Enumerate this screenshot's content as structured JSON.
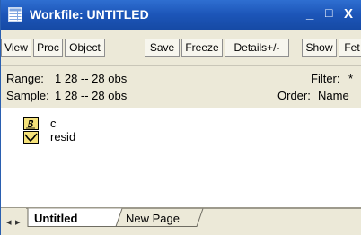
{
  "window": {
    "title": "Workfile: UNTITLED",
    "controls": {
      "minimize": "_",
      "maximize": "□",
      "close": "X"
    }
  },
  "toolbar": {
    "buttons": [
      "View",
      "Proc",
      "Object",
      "Save",
      "Freeze",
      "Details+/-",
      "Show",
      "Fet"
    ]
  },
  "info": {
    "range_label": "Range:",
    "range_value": "1 28  --  28 obs",
    "filter_label": "Filter:",
    "filter_value": "*",
    "sample_label": "Sample:",
    "sample_value": "1 28  --  28 obs",
    "order_label": "Order:",
    "order_value": "Name"
  },
  "objects": [
    {
      "icon": "coefficient-icon",
      "name": "c"
    },
    {
      "icon": "series-icon",
      "name": "resid"
    }
  ],
  "tabs": {
    "nav_prev": "◂",
    "nav_next": "▸",
    "items": [
      "Untitled",
      "New Page"
    ],
    "active": "Untitled"
  },
  "colors": {
    "titlebar": "#1c55b8",
    "panel": "#ece9d8",
    "icon_yellow": "#f5e27a"
  }
}
